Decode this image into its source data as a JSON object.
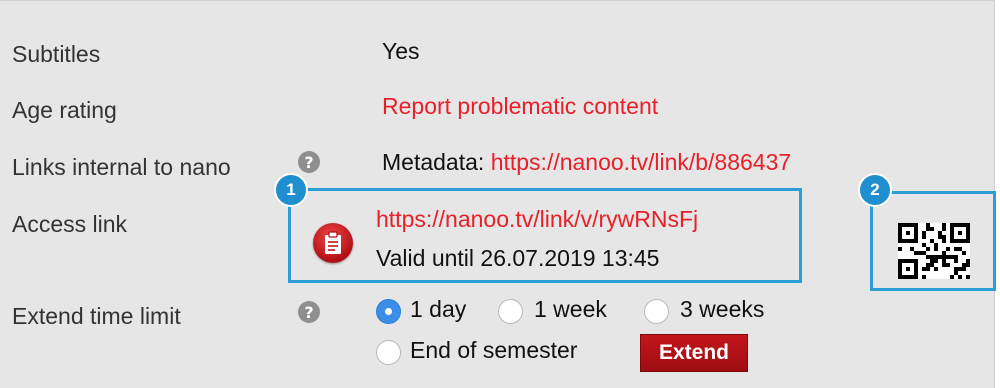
{
  "rows": {
    "subtitles": {
      "label": "Subtitles",
      "value": "Yes"
    },
    "age_rating": {
      "label": "Age rating",
      "value": "Report problematic content"
    },
    "links_internal": {
      "label": "Links internal to nano",
      "prefix": "Metadata:",
      "link": "https://nanoo.tv/link/b/886437"
    },
    "access_link": {
      "label": "Access link",
      "link": "https://nanoo.tv/link/v/rywRNsFj",
      "valid_until": "Valid until 26.07.2019 13:45"
    },
    "extend": {
      "label": "Extend time limit",
      "options": [
        "1 day",
        "1 week",
        "3 weeks",
        "End of semester"
      ],
      "selected": "1 day",
      "button": "Extend"
    }
  },
  "help_glyph": "?",
  "callouts": {
    "one": "1",
    "two": "2"
  },
  "icons": {
    "help": "question-mark-circle",
    "access": "clipboard-icon",
    "qr": "qr-code"
  },
  "colors": {
    "link": "#e8202a",
    "callout": "#2b9fd5",
    "button": "#b01218",
    "radio_selected": "#3b8ee8"
  }
}
